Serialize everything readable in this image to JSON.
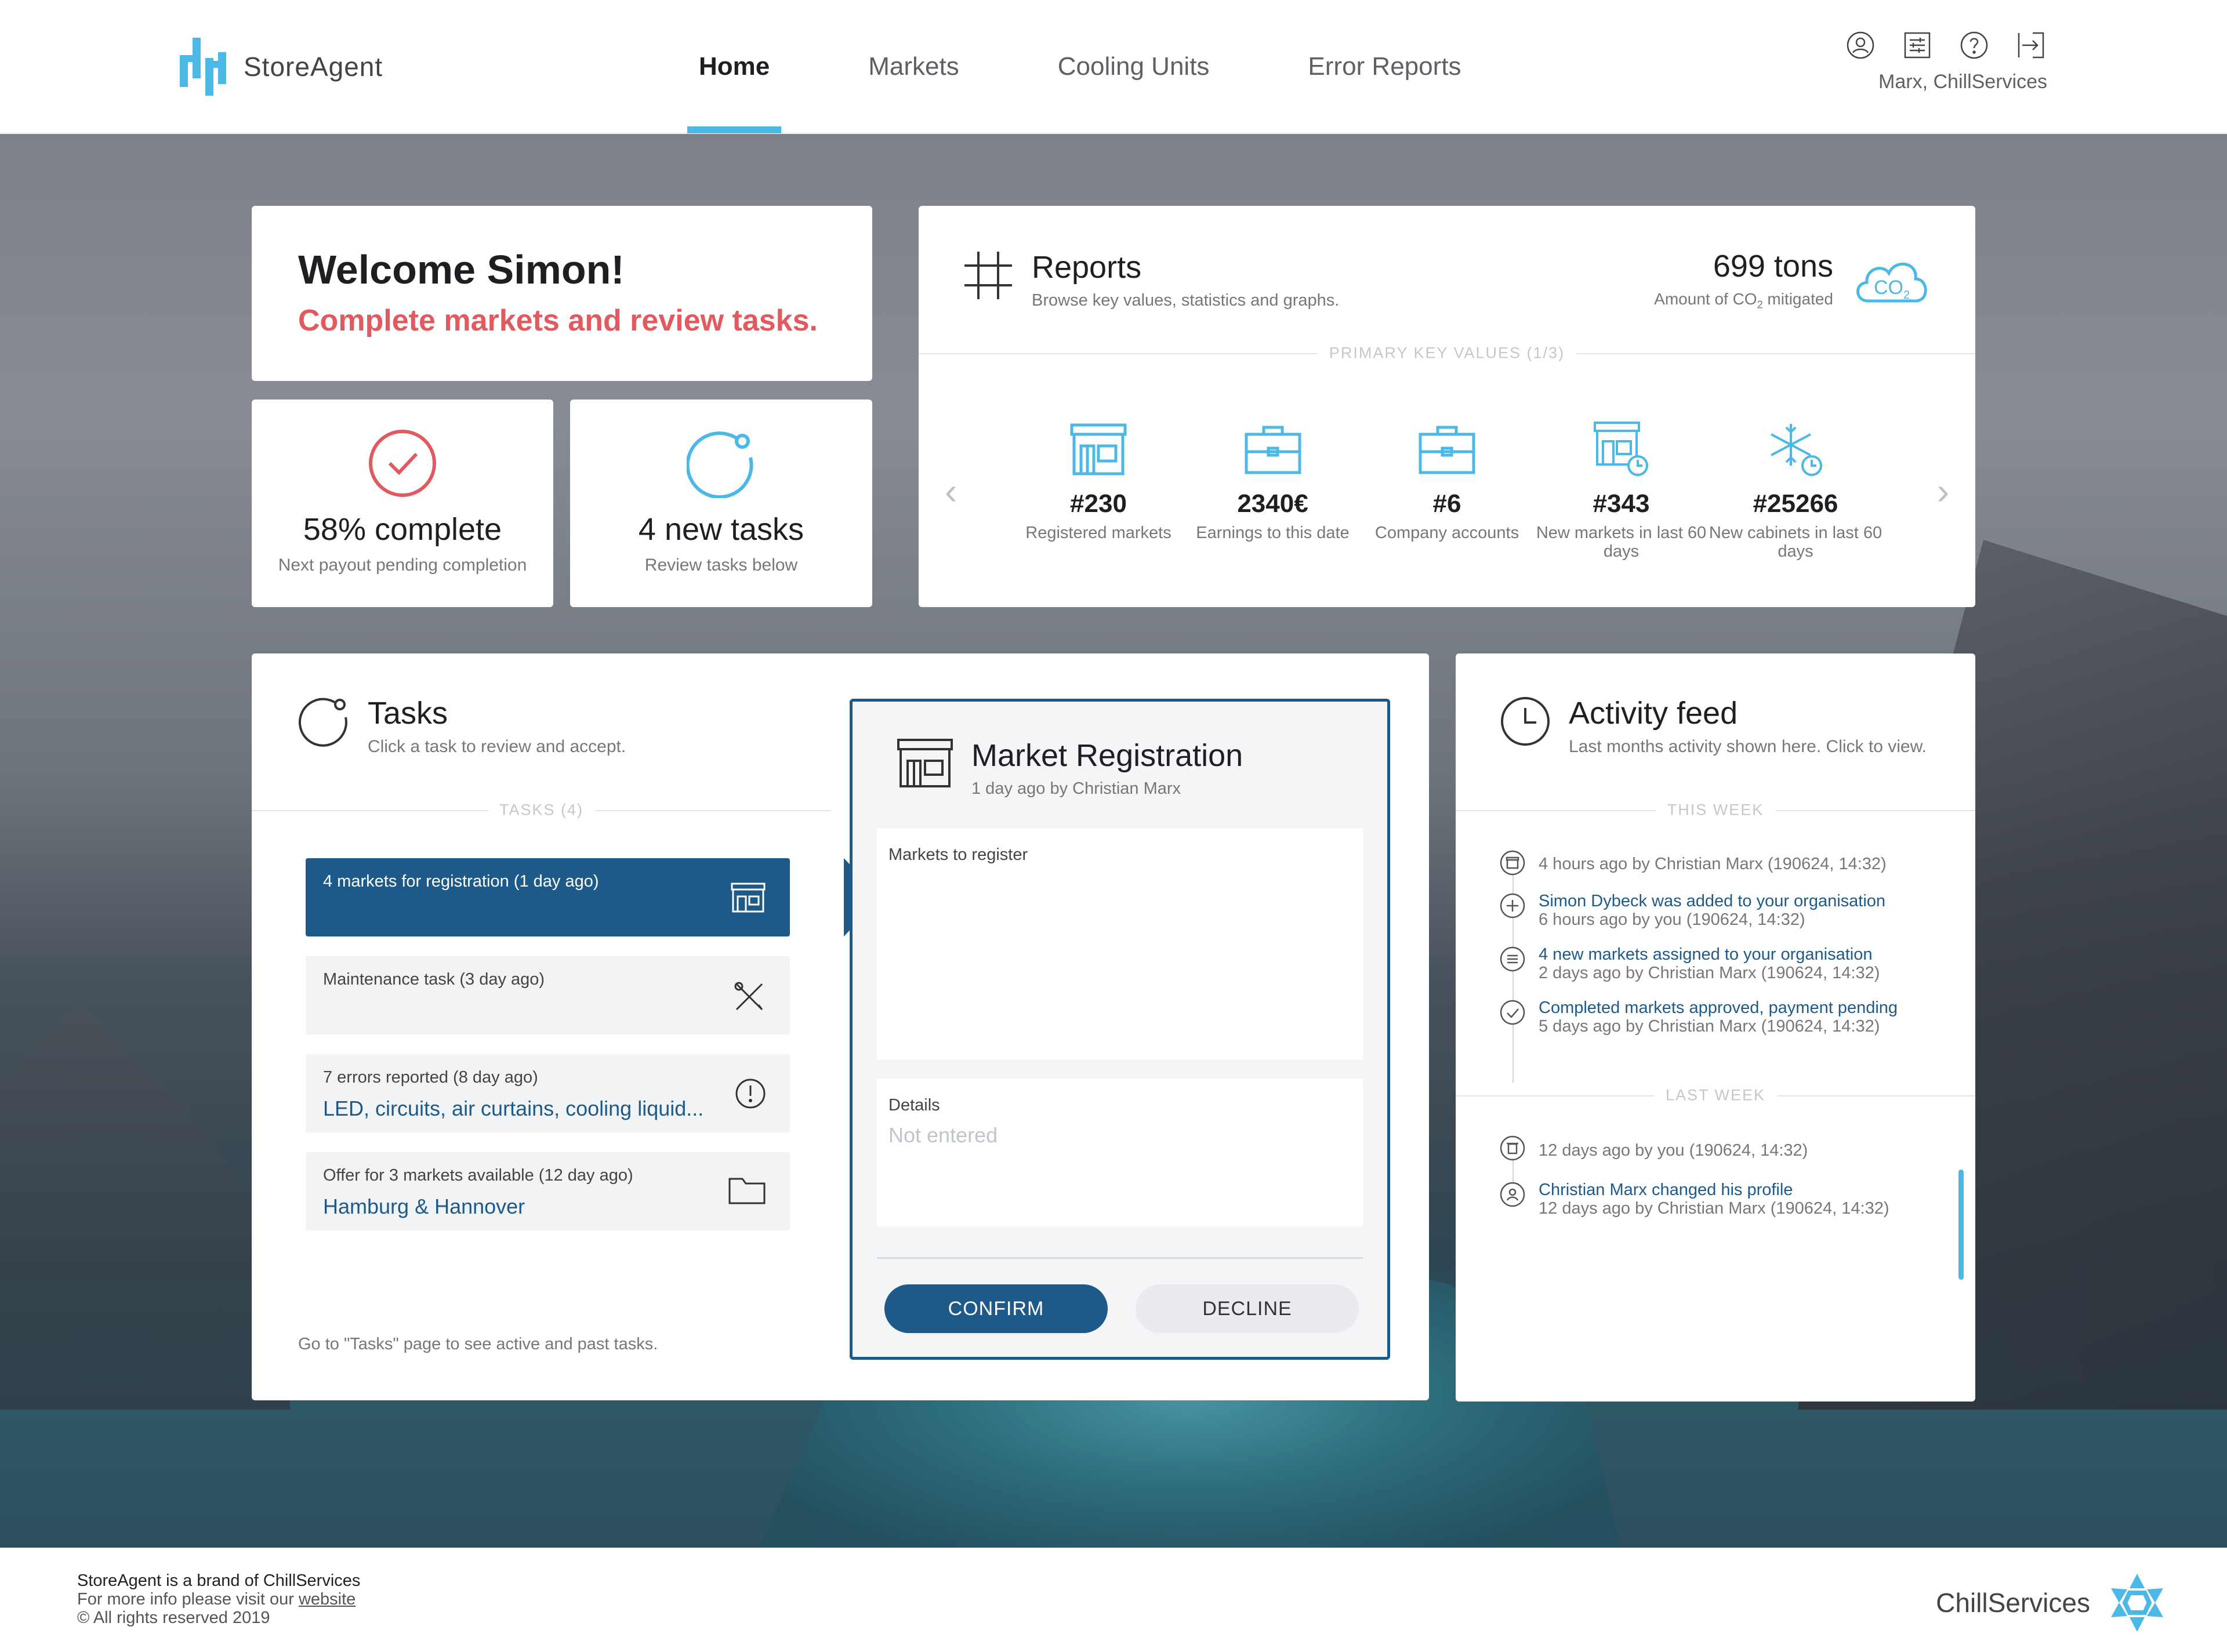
{
  "header": {
    "app_name": "StoreAgent",
    "nav": [
      "Home",
      "Markets",
      "Cooling Units",
      "Error Reports"
    ],
    "active_nav": "Home",
    "user": "Marx, ChillServices",
    "icons": [
      "user-icon",
      "settings-icon",
      "help-icon",
      "logout-icon"
    ]
  },
  "welcome": {
    "title": "Welcome Simon!",
    "subtitle": "Complete markets and review tasks."
  },
  "stats": [
    {
      "value": "58% complete",
      "label": "Next payout pending completion",
      "icon": "check-circle-icon",
      "color": "#e05a5f"
    },
    {
      "value": "4 new tasks",
      "label": "Review tasks below",
      "icon": "task-ring-icon",
      "color": "#4cb8e6"
    }
  ],
  "reports": {
    "title": "Reports",
    "subtitle": "Browse key values, statistics and graphs.",
    "co2_value": "699 tons",
    "co2_label_prefix": "Amount of CO",
    "co2_label_sub": "2",
    "co2_label_suffix": " mitigated",
    "co2_icon_text": "CO",
    "co2_icon_sub": "2",
    "section_label": "PRIMARY KEY VALUES (1/3)",
    "kpis": [
      {
        "value": "#230",
        "label": "Registered markets",
        "icon": "store-icon"
      },
      {
        "value": "2340€",
        "label": "Earnings to this date",
        "icon": "briefcase-icon"
      },
      {
        "value": "#6",
        "label": "Company accounts",
        "icon": "briefcase-icon"
      },
      {
        "value": "#343",
        "label": "New markets in last 60 days",
        "icon": "store-clock-icon"
      },
      {
        "value": "#25266",
        "label": "New cabinets in last 60 days",
        "icon": "snowflake-clock-icon"
      }
    ]
  },
  "tasks": {
    "title": "Tasks",
    "subtitle": "Click a task to review and accept.",
    "section_label": "TASKS (4)",
    "items": [
      {
        "label": "4 markets for registration (1 day ago)",
        "value": "",
        "icon": "store-icon"
      },
      {
        "label": "Maintenance task (3 day ago)",
        "value": "",
        "icon": "tools-icon"
      },
      {
        "label": "7 errors reported (8 day ago)",
        "value": "LED, circuits, air curtains, cooling liquid...",
        "icon": "alert-icon"
      },
      {
        "label": "Offer for 3 markets available (12 day ago)",
        "value": "Hamburg & Hannover",
        "icon": "folder-icon"
      }
    ],
    "footer": "Go to \"Tasks\" page to see active and past tasks."
  },
  "market_registration": {
    "title": "Market Registration",
    "subtitle": "1 day ago by Christian Marx",
    "markets_label": "Markets to register",
    "details_label": "Details",
    "details_value": "Not entered",
    "confirm": "CONFIRM",
    "decline": "DECLINE"
  },
  "activity": {
    "title": "Activity feed",
    "subtitle": "Last months activity shown here. Click to view.",
    "this_week_label": "THIS WEEK",
    "last_week_label": "LAST WEEK",
    "this_week": [
      {
        "title": "",
        "detail": "4 hours ago by Christian Marx (190624, 14:32)",
        "icon": "store-icon"
      },
      {
        "title": "Simon Dybeck was added to your organisation",
        "detail": "6 hours ago by you (190624, 14:32)",
        "icon": "plus-icon"
      },
      {
        "title": "4 new markets assigned to your organisation",
        "detail": "2 days ago by Christian Marx (190624, 14:32)",
        "icon": "list-icon"
      },
      {
        "title": "Completed markets approved, payment pending",
        "detail": "5 days ago by Christian Marx (190624, 14:32)",
        "icon": "check-icon"
      }
    ],
    "last_week": [
      {
        "title": "",
        "detail": "12 days ago by you (190624, 14:32)",
        "icon": "trash-icon"
      },
      {
        "title": "Christian Marx changed his profile",
        "detail": "12 days ago by Christian Marx (190624, 14:32)",
        "icon": "user-icon"
      }
    ]
  },
  "footer": {
    "line1": "StoreAgent is a brand of ChillServices",
    "line2_prefix": "For more info please visit our ",
    "line2_link": "website",
    "line3": "© All rights reserved 2019",
    "brand": "ChillServices"
  },
  "colors": {
    "accent": "#4cb8e6",
    "primary": "#1d5a8a",
    "alert": "#e05a5f"
  }
}
